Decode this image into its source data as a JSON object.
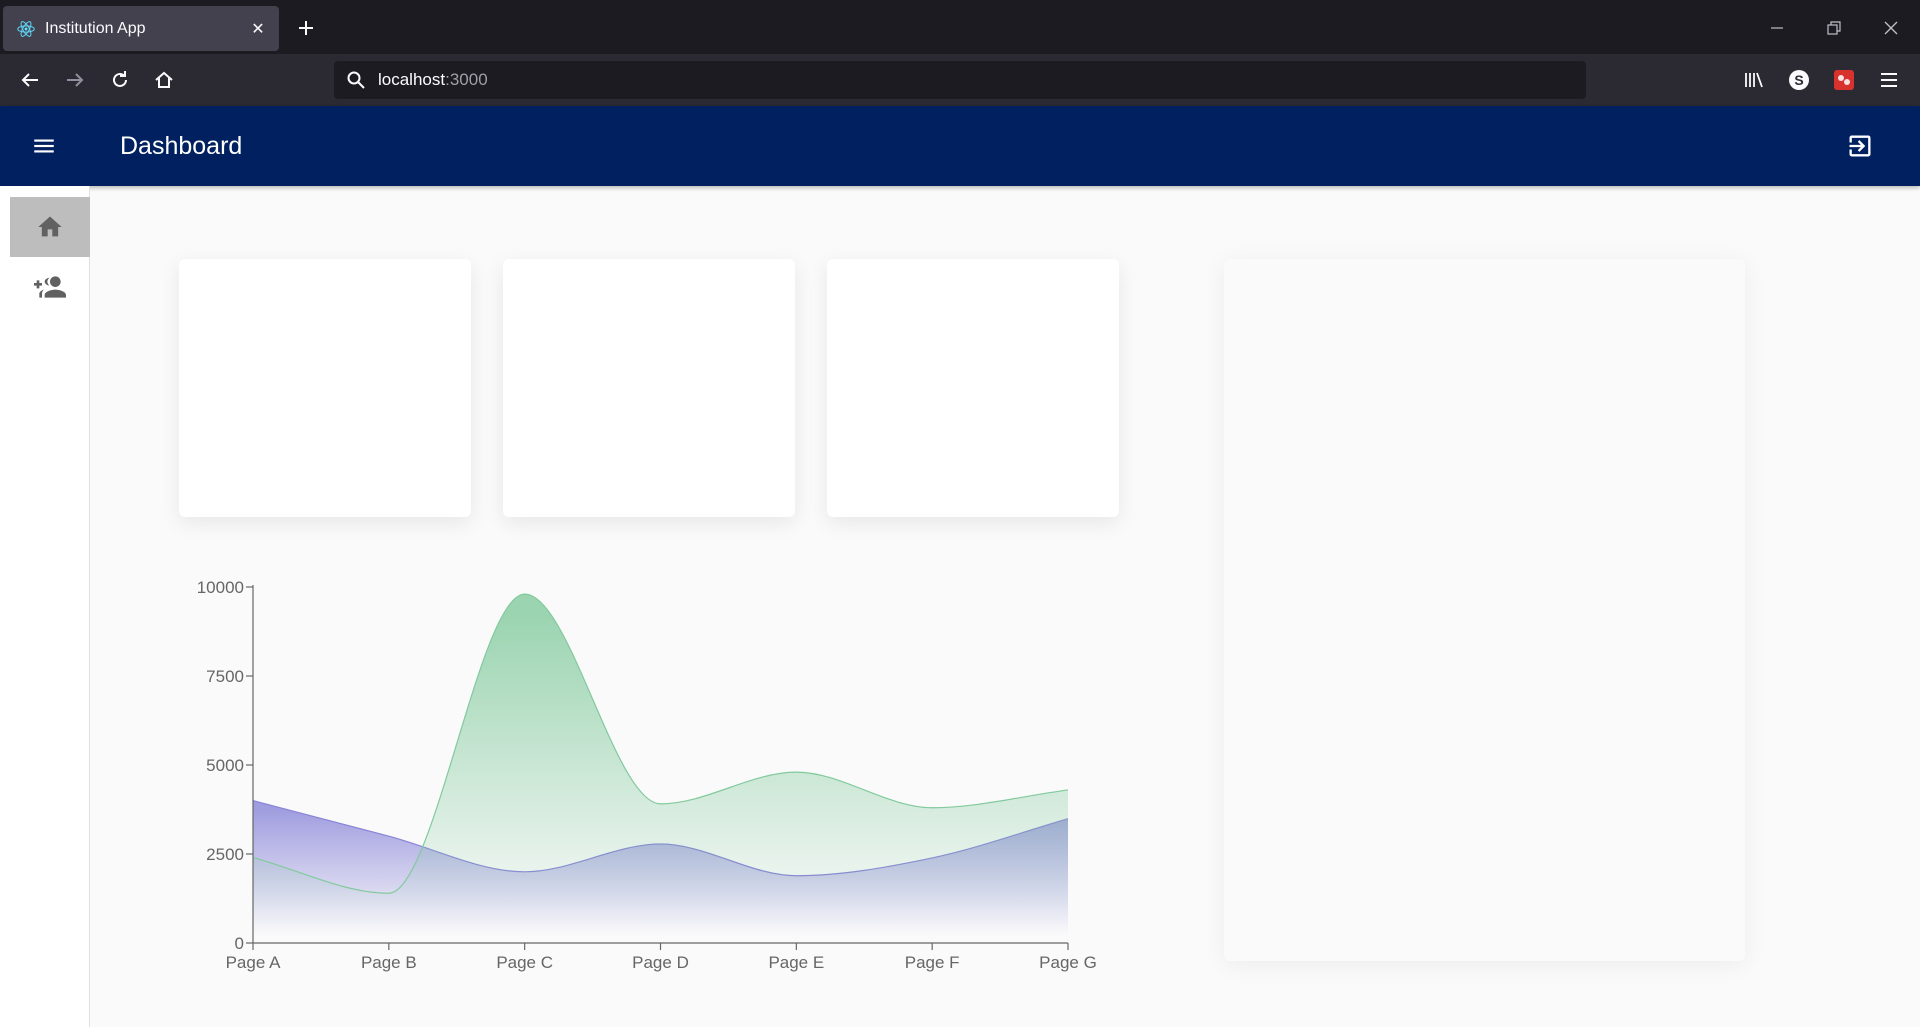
{
  "browser": {
    "tab_title": "Institution App",
    "url_host": "localhost",
    "url_port": ":3000"
  },
  "appbar": {
    "title": "Dashboard"
  },
  "sidebar": {
    "items": [
      {
        "icon": "home-icon",
        "active": true
      },
      {
        "icon": "group-add-icon",
        "active": false
      }
    ]
  },
  "colors": {
    "appbar": "#002060",
    "series_green": "#82ca9d",
    "series_purple": "#8884d8"
  },
  "chart_data": {
    "type": "area",
    "categories": [
      "Page A",
      "Page B",
      "Page C",
      "Page D",
      "Page E",
      "Page F",
      "Page G"
    ],
    "series": [
      {
        "values": [
          4000,
          3000,
          2000,
          2780,
          1890,
          2390,
          3490
        ],
        "color": "#8884d8"
      },
      {
        "values": [
          2400,
          1398,
          9800,
          3908,
          4800,
          3800,
          4300
        ],
        "color": "#82ca9d"
      }
    ],
    "yticks": [
      "0",
      "2500",
      "5000",
      "7500",
      "10000"
    ],
    "ylim": [
      0,
      10000
    ],
    "curve": "smooth",
    "gradient_fill": true
  }
}
